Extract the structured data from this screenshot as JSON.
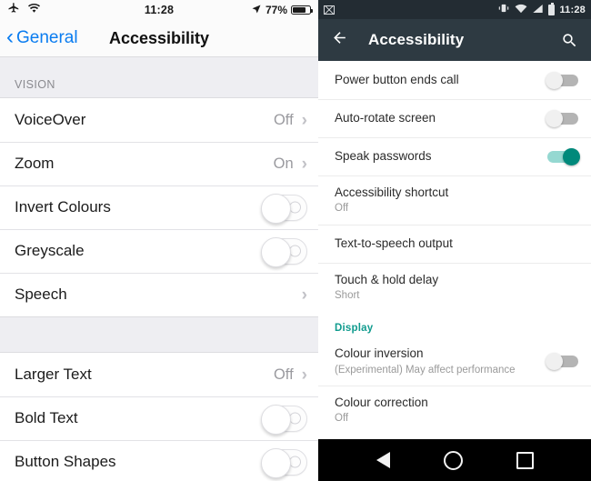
{
  "ios": {
    "status": {
      "airplane_icon": "airplane-icon",
      "wifi_icon": "wifi-icon",
      "time": "11:28",
      "location_icon": "location-arrow-icon",
      "battery_percent": "77%",
      "battery_icon": "battery-icon"
    },
    "navbar": {
      "back_chevron": "‹",
      "back_label": "General",
      "title": "Accessibility"
    },
    "sections": [
      {
        "header": "VISION",
        "rows": [
          {
            "label": "VoiceOver",
            "value": "Off",
            "control": "disclosure"
          },
          {
            "label": "Zoom",
            "value": "On",
            "control": "disclosure"
          },
          {
            "label": "Invert Colours",
            "value": "",
            "control": "switch",
            "on": false
          },
          {
            "label": "Greyscale",
            "value": "",
            "control": "switch",
            "on": false
          },
          {
            "label": "Speech",
            "value": "",
            "control": "disclosure"
          }
        ]
      },
      {
        "header": "",
        "rows": [
          {
            "label": "Larger Text",
            "value": "Off",
            "control": "disclosure"
          },
          {
            "label": "Bold Text",
            "value": "",
            "control": "switch",
            "on": false
          },
          {
            "label": "Button Shapes",
            "value": "",
            "control": "switch",
            "on": false
          }
        ]
      }
    ],
    "disclosure_glyph": "›"
  },
  "android": {
    "status": {
      "gmail_icon": "gmail-icon",
      "vibrate_icon": "vibrate-icon",
      "wifi_icon": "wifi-icon",
      "signal_icon": "signal-icon",
      "battery_icon": "battery-icon",
      "time": "11:28"
    },
    "appbar": {
      "back_icon": "back-arrow-icon",
      "title": "Accessibility",
      "search_icon": "search-icon"
    },
    "rows": [
      {
        "title": "Power button ends call",
        "sub": "",
        "control": "switch",
        "on": false
      },
      {
        "title": "Auto-rotate screen",
        "sub": "",
        "control": "switch",
        "on": false
      },
      {
        "title": "Speak passwords",
        "sub": "",
        "control": "switch",
        "on": true
      },
      {
        "title": "Accessibility shortcut",
        "sub": "Off",
        "control": "none"
      },
      {
        "title": "Text-to-speech output",
        "sub": "",
        "control": "none"
      },
      {
        "title": "Touch & hold delay",
        "sub": "Short",
        "control": "none"
      }
    ],
    "display_section": {
      "header": "Display",
      "rows": [
        {
          "title": "Colour inversion",
          "sub": "(Experimental) May affect performance",
          "control": "switch",
          "on": false
        },
        {
          "title": "Colour correction",
          "sub": "Off",
          "control": "none"
        }
      ]
    },
    "navbar": {
      "back_icon": "nav-back-triangle-icon",
      "home_icon": "nav-home-circle-icon",
      "recents_icon": "nav-recents-square-icon"
    }
  },
  "colors": {
    "ios_accent": "#0a7cf0",
    "android_appbar": "#2e3a42",
    "android_statusbar": "#232c33",
    "android_accent": "#109b8e",
    "android_switch_on": "#00897b"
  }
}
